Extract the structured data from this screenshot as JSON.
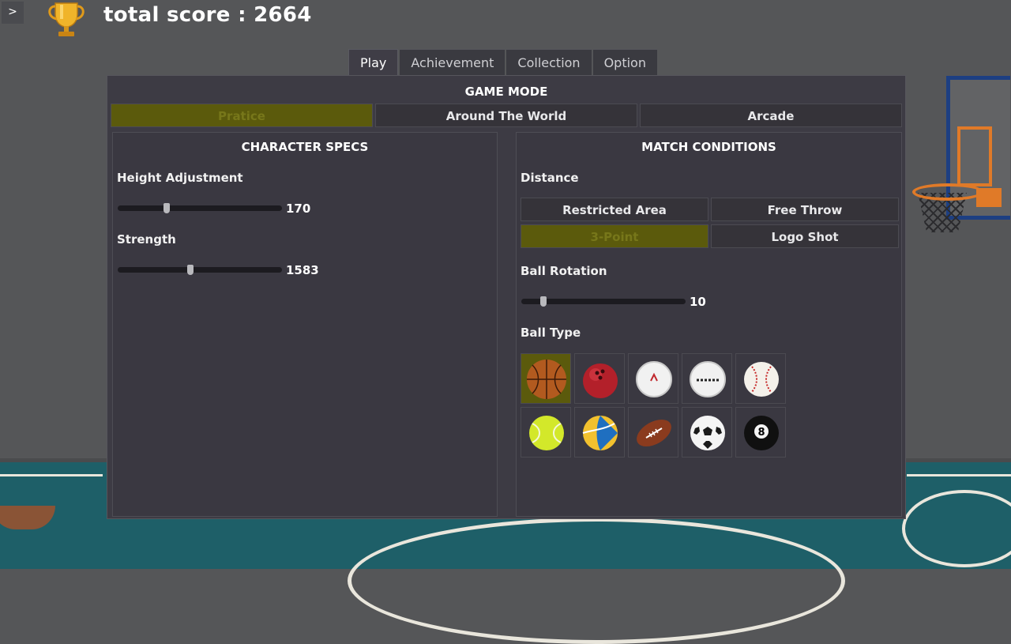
{
  "header": {
    "menu_toggle": ">",
    "trophy_icon": "trophy-icon",
    "score_text": "total score : 2664"
  },
  "tabs": [
    {
      "label": "Play",
      "active": true
    },
    {
      "label": "Achievement",
      "active": false
    },
    {
      "label": "Collection",
      "active": false
    },
    {
      "label": "Option",
      "active": false
    }
  ],
  "game_mode": {
    "title": "GAME MODE",
    "modes": [
      {
        "label": "Pratice",
        "selected": true
      },
      {
        "label": "Around The World",
        "selected": false
      },
      {
        "label": "Arcade",
        "selected": false
      }
    ]
  },
  "character_specs": {
    "title": "CHARACTER SPECS",
    "height": {
      "label": "Height Adjustment",
      "value": "170",
      "fraction": 0.29
    },
    "strength": {
      "label": "Strength",
      "value": "1583",
      "fraction": 0.44
    }
  },
  "match_conditions": {
    "title": "MATCH CONDITIONS",
    "distance": {
      "label": "Distance",
      "options": [
        {
          "label": "Restricted Area",
          "selected": false
        },
        {
          "label": "Free Throw",
          "selected": false
        },
        {
          "label": "3-Point",
          "selected": true
        },
        {
          "label": "Logo Shot",
          "selected": false
        }
      ]
    },
    "ball_rotation": {
      "label": "Ball Rotation",
      "value": "10",
      "fraction": 0.12
    },
    "ball_type": {
      "label": "Ball Type",
      "balls": [
        {
          "icon": "basketball-icon",
          "selected": true
        },
        {
          "icon": "bowling-ball-icon",
          "selected": false
        },
        {
          "icon": "golf-ball-icon",
          "selected": false
        },
        {
          "icon": "golf-ball-icon",
          "selected": false
        },
        {
          "icon": "baseball-icon",
          "selected": false
        },
        {
          "icon": "tennis-ball-icon",
          "selected": false
        },
        {
          "icon": "volleyball-icon",
          "selected": false
        },
        {
          "icon": "football-icon",
          "selected": false
        },
        {
          "icon": "soccer-ball-icon",
          "selected": false
        },
        {
          "icon": "eight-ball-icon",
          "selected": false
        }
      ]
    }
  },
  "colors": {
    "selected_bg": "#5b5a0c",
    "panel_bg": "#3d3b44",
    "court": "#1e5f68",
    "rim": "#e07a28"
  }
}
